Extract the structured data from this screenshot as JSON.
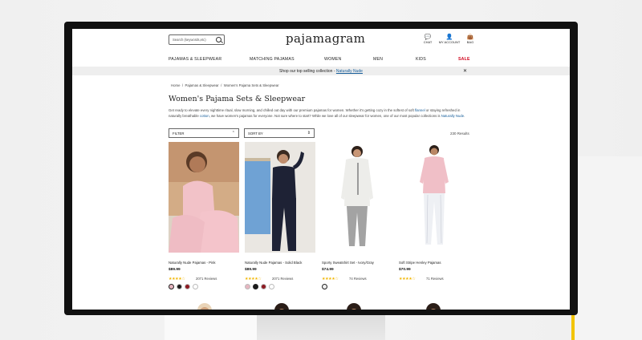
{
  "header": {
    "search_placeholder": "Search (keywords,etc)",
    "logo": "pajamagram",
    "chat": "CHAT",
    "account": "MY ACCOUNT",
    "bag": "BAG"
  },
  "nav": [
    "PAJAMAS & SLEEPWEAR",
    "MATCHING PAJAMAS",
    "WOMEN",
    "MEN",
    "KIDS",
    "SALE"
  ],
  "promo": {
    "text": "Shop our top selling collection - ",
    "link": "Naturally Nude"
  },
  "breadcrumb": [
    "Home",
    "Pajamas & Sleepwear",
    "Women's Pajama Sets & Sleepwear"
  ],
  "page": {
    "title": "Women's Pajama Sets & Sleepwear",
    "desc_1": "Get ready to elevate every nighttime ritual, slow morning, and chilled out day with our premium pajamas for women. Whether it's getting cozy in the softest of soft ",
    "desc_link1": "flannel",
    "desc_2": " or staying refreshed in naturally breathable ",
    "desc_link2": "cotton",
    "desc_3": ", we have women's pajamas for everyone. Not sure where to start? While we love all of our sleepwear for women, one of our most popular collections is ",
    "desc_link3": "Naturally Nude",
    "desc_4": ".",
    "filter": "FILTER",
    "sort": "SORT BY",
    "results": "230 Results"
  },
  "products": [
    {
      "name": "Naturally Nude Pajamas - Pink",
      "price": "$89.99",
      "reviews": "2071 Reviews",
      "swatches": [
        "#e6b6c0",
        "#1b1b1b",
        "#8e1a22",
        "#ffffff"
      ]
    },
    {
      "name": "Naturally Nude Pajamas - Solid Black",
      "price": "$89.99",
      "reviews": "2071 Reviews",
      "swatches": [
        "#e6b6c0",
        "#1b1b1b",
        "#8e1a22",
        "#ffffff"
      ]
    },
    {
      "name": "Sporty Sweatshirt Set - Ivory/Gray",
      "price": "$74.99",
      "reviews": "74 Reviews",
      "swatches": [
        "#efefef"
      ]
    },
    {
      "name": "Soft Stripe Henley Pajamas",
      "price": "$70.99",
      "reviews": "71 Reviews",
      "swatches": []
    }
  ],
  "colors": {
    "accent": "#155c99",
    "star": "#f2b600",
    "sale": "#d0021b"
  }
}
